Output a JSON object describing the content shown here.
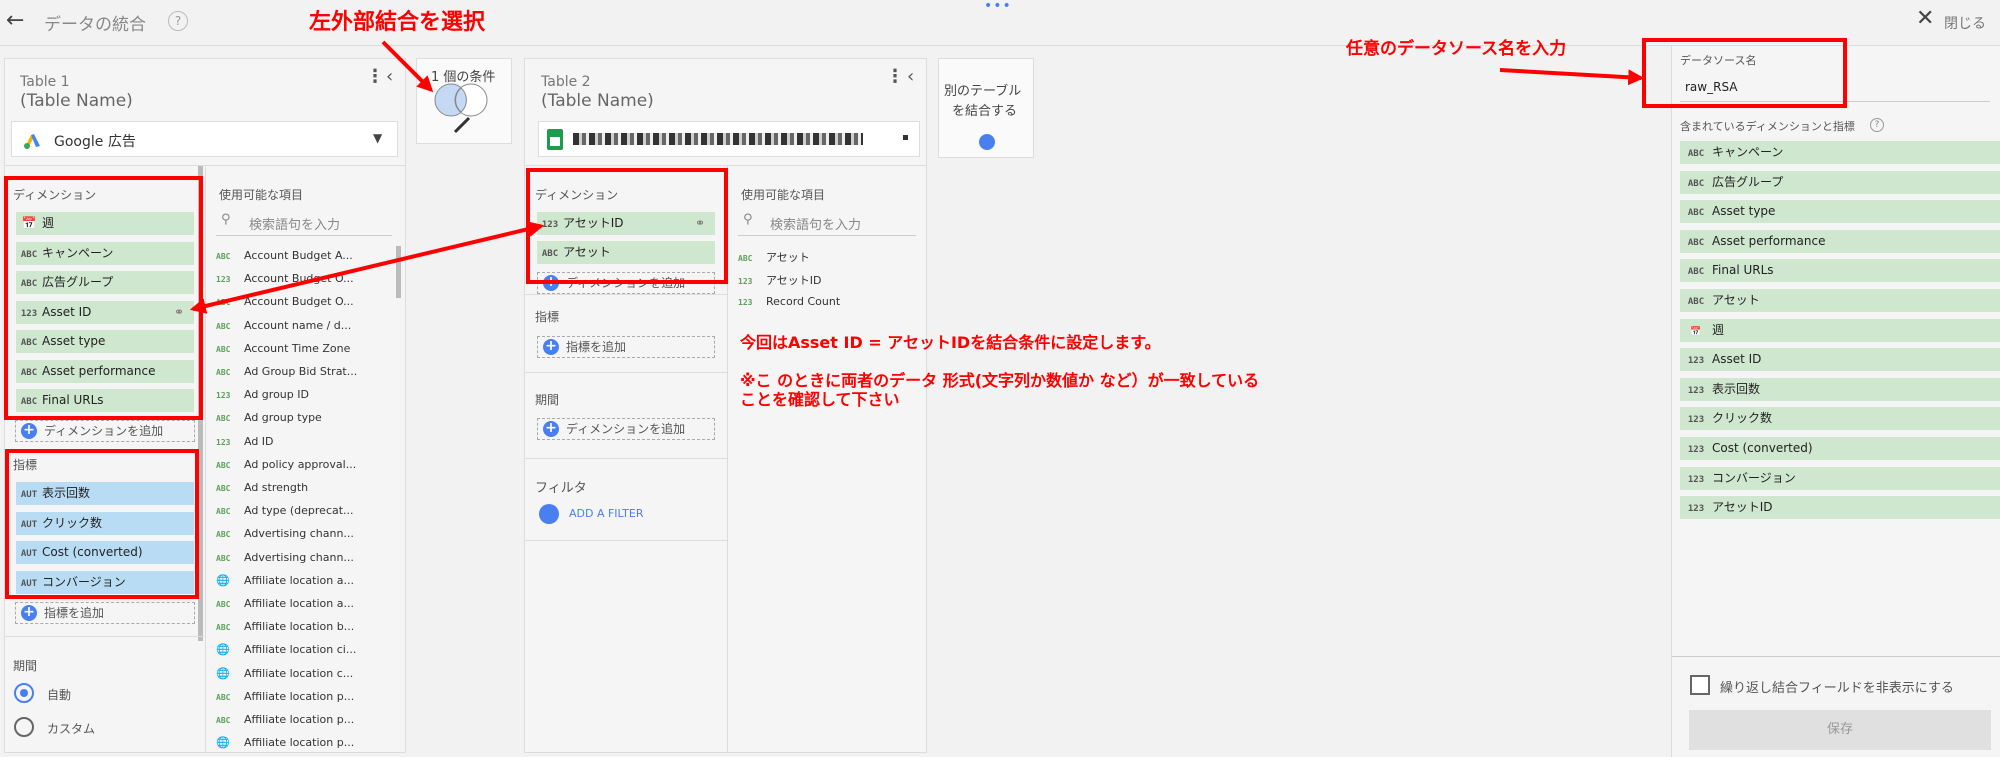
{
  "topbar": {
    "title": "データの統合",
    "help": "?",
    "close_label": "閉じる"
  },
  "table1": {
    "title": "Table 1",
    "name_placeholder": "(Table Name)",
    "source": "Google 広告",
    "dimensions_label": "ディメンション",
    "dimensions": [
      {
        "type": "cal",
        "label": "週"
      },
      {
        "type": "ABC",
        "label": "キャンペーン"
      },
      {
        "type": "ABC",
        "label": "広告グループ"
      },
      {
        "type": "123",
        "label": "Asset ID",
        "linked": true
      },
      {
        "type": "ABC",
        "label": "Asset type"
      },
      {
        "type": "ABC",
        "label": "Asset performance"
      },
      {
        "type": "ABC",
        "label": "Final URLs"
      }
    ],
    "add_dimension": "ディメンションを追加",
    "metrics_label": "指標",
    "metrics": [
      {
        "type": "AUT",
        "label": "表示回数"
      },
      {
        "type": "AUT",
        "label": "クリック数"
      },
      {
        "type": "AUT",
        "label": "Cost (converted)"
      },
      {
        "type": "AUT",
        "label": "コンバージョン"
      }
    ],
    "add_metric": "指標を追加",
    "period_label": "期間",
    "period_options": [
      "自動",
      "カスタム"
    ],
    "available_label": "使用可能な項目",
    "search_placeholder": "検索語句を入力",
    "available": [
      {
        "t": "ABC",
        "label": "Account Budget A..."
      },
      {
        "t": "123",
        "label": "Account Budget O..."
      },
      {
        "t": "ABC",
        "label": "Account Budget O..."
      },
      {
        "t": "ABC",
        "label": "Account name / d..."
      },
      {
        "t": "ABC",
        "label": "Account Time Zone"
      },
      {
        "t": "ABC",
        "label": "Ad Group Bid Strat..."
      },
      {
        "t": "123",
        "label": "Ad group ID"
      },
      {
        "t": "ABC",
        "label": "Ad group type"
      },
      {
        "t": "123",
        "label": "Ad ID"
      },
      {
        "t": "ABC",
        "label": "Ad policy approval..."
      },
      {
        "t": "ABC",
        "label": "Ad strength"
      },
      {
        "t": "ABC",
        "label": "Ad type (deprecat..."
      },
      {
        "t": "ABC",
        "label": "Advertising chann..."
      },
      {
        "t": "ABC",
        "label": "Advertising chann..."
      },
      {
        "t": "geo",
        "label": "Affiliate location a..."
      },
      {
        "t": "ABC",
        "label": "Affiliate location a..."
      },
      {
        "t": "ABC",
        "label": "Affiliate location b..."
      },
      {
        "t": "geo",
        "label": "Affiliate location ci..."
      },
      {
        "t": "geo",
        "label": "Affiliate location c..."
      },
      {
        "t": "ABC",
        "label": "Affiliate location p..."
      },
      {
        "t": "ABC",
        "label": "Affiliate location p..."
      },
      {
        "t": "geo",
        "label": "Affiliate location p..."
      }
    ]
  },
  "join": {
    "label": "1 個の条件"
  },
  "table2": {
    "title": "Table 2",
    "name_placeholder": "(Table Name)",
    "dimensions_label": "ディメンション",
    "dimensions": [
      {
        "type": "123",
        "label": "アセットID",
        "linked": true
      },
      {
        "type": "ABC",
        "label": "アセット"
      }
    ],
    "add_dimension": "ディメンションを追加",
    "metrics_label": "指標",
    "add_metric": "指標を追加",
    "period_label": "期間",
    "add_period_dimension": "ディメンションを追加",
    "filter_label": "フィルタ",
    "add_filter": "ADD A FILTER",
    "available_label": "使用可能な項目",
    "search_placeholder": "検索語句を入力",
    "available": [
      {
        "t": "ABC",
        "label": "アセット"
      },
      {
        "t": "123",
        "label": "アセットID"
      },
      {
        "t": "123",
        "label": "Record Count"
      }
    ]
  },
  "add_table": {
    "label_line1": "別のテーブル",
    "label_line2": "を結合する"
  },
  "right": {
    "source_name_label": "データソース名",
    "source_name_value": "raw_RSA",
    "included_label": "含まれているディメンションと指標",
    "included": [
      {
        "type": "ABC",
        "label": "キャンペーン"
      },
      {
        "type": "ABC",
        "label": "広告グループ"
      },
      {
        "type": "ABC",
        "label": "Asset type"
      },
      {
        "type": "ABC",
        "label": "Asset performance"
      },
      {
        "type": "ABC",
        "label": "Final URLs"
      },
      {
        "type": "ABC",
        "label": "アセット"
      },
      {
        "type": "cal",
        "label": "週"
      },
      {
        "type": "123",
        "label": "Asset ID"
      },
      {
        "type": "123",
        "label": "表示回数"
      },
      {
        "type": "123",
        "label": "クリック数"
      },
      {
        "type": "123",
        "label": "Cost (converted)"
      },
      {
        "type": "123",
        "label": "コンバージョン"
      },
      {
        "type": "123",
        "label": "アセットID"
      }
    ],
    "hide_repeat_label": "繰り返し結合フィールドを非表示にする",
    "save_label": "保存"
  },
  "annotations": {
    "select_left_join": "左外部結合を選択",
    "enter_source_name": "任意のデータソース名を入力",
    "join_note": "今回はAsset ID = アセットIDを結合条件に設定します。",
    "format_note_1": "※こ のときに両者のデータ 形式(文字列か数値か など）が一致している",
    "format_note_2": "ことを確認して下さい"
  },
  "colors": {
    "dimension_chip": "#cfe6cf",
    "metric_chip": "#b9dcf5",
    "accent": "#4a7ff0",
    "annotation": "#ff0000"
  }
}
